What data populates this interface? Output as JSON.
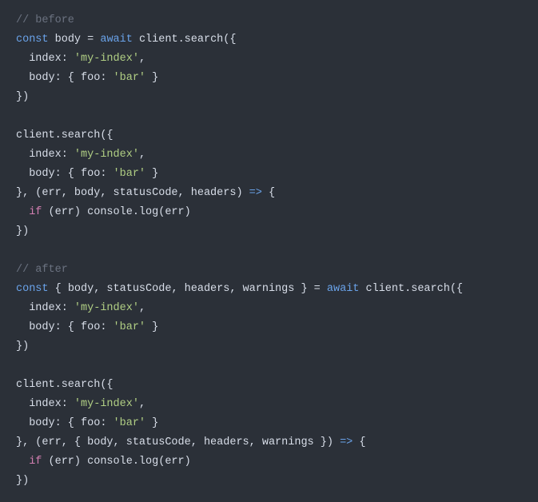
{
  "code": {
    "lines": [
      {
        "tokens": [
          {
            "t": "// before",
            "c": "cmt"
          }
        ]
      },
      {
        "tokens": [
          {
            "t": "const",
            "c": "kw"
          },
          {
            "t": " body ",
            "c": "ident"
          },
          {
            "t": "=",
            "c": "op"
          },
          {
            "t": " ",
            "c": "ident"
          },
          {
            "t": "await",
            "c": "kw"
          },
          {
            "t": " client.search({",
            "c": "ident"
          }
        ]
      },
      {
        "tokens": [
          {
            "t": "  index: ",
            "c": "ident"
          },
          {
            "t": "'my-index'",
            "c": "str"
          },
          {
            "t": ",",
            "c": "punct"
          }
        ]
      },
      {
        "tokens": [
          {
            "t": "  body: { foo: ",
            "c": "ident"
          },
          {
            "t": "'bar'",
            "c": "str"
          },
          {
            "t": " }",
            "c": "punct"
          }
        ]
      },
      {
        "tokens": [
          {
            "t": "})",
            "c": "punct"
          }
        ]
      },
      {
        "tokens": [
          {
            "t": "",
            "c": "ident"
          }
        ]
      },
      {
        "tokens": [
          {
            "t": "client.search({",
            "c": "ident"
          }
        ]
      },
      {
        "tokens": [
          {
            "t": "  index: ",
            "c": "ident"
          },
          {
            "t": "'my-index'",
            "c": "str"
          },
          {
            "t": ",",
            "c": "punct"
          }
        ]
      },
      {
        "tokens": [
          {
            "t": "  body: { foo: ",
            "c": "ident"
          },
          {
            "t": "'bar'",
            "c": "str"
          },
          {
            "t": " }",
            "c": "punct"
          }
        ]
      },
      {
        "tokens": [
          {
            "t": "}, (err, body, statusCode, headers) ",
            "c": "ident"
          },
          {
            "t": "=>",
            "c": "kw"
          },
          {
            "t": " {",
            "c": "punct"
          }
        ]
      },
      {
        "tokens": [
          {
            "t": "  ",
            "c": "ident"
          },
          {
            "t": "if",
            "c": "kw2"
          },
          {
            "t": " (err) console.log(err)",
            "c": "ident"
          }
        ]
      },
      {
        "tokens": [
          {
            "t": "})",
            "c": "punct"
          }
        ]
      },
      {
        "tokens": [
          {
            "t": "",
            "c": "ident"
          }
        ]
      },
      {
        "tokens": [
          {
            "t": "// after",
            "c": "cmt"
          }
        ]
      },
      {
        "tokens": [
          {
            "t": "const",
            "c": "kw"
          },
          {
            "t": " { body, statusCode, headers, warnings } ",
            "c": "ident"
          },
          {
            "t": "=",
            "c": "op"
          },
          {
            "t": " ",
            "c": "ident"
          },
          {
            "t": "await",
            "c": "kw"
          },
          {
            "t": " client.search({",
            "c": "ident"
          }
        ]
      },
      {
        "tokens": [
          {
            "t": "  index: ",
            "c": "ident"
          },
          {
            "t": "'my-index'",
            "c": "str"
          },
          {
            "t": ",",
            "c": "punct"
          }
        ]
      },
      {
        "tokens": [
          {
            "t": "  body: { foo: ",
            "c": "ident"
          },
          {
            "t": "'bar'",
            "c": "str"
          },
          {
            "t": " }",
            "c": "punct"
          }
        ]
      },
      {
        "tokens": [
          {
            "t": "})",
            "c": "punct"
          }
        ]
      },
      {
        "tokens": [
          {
            "t": "",
            "c": "ident"
          }
        ]
      },
      {
        "tokens": [
          {
            "t": "client.search({",
            "c": "ident"
          }
        ]
      },
      {
        "tokens": [
          {
            "t": "  index: ",
            "c": "ident"
          },
          {
            "t": "'my-index'",
            "c": "str"
          },
          {
            "t": ",",
            "c": "punct"
          }
        ]
      },
      {
        "tokens": [
          {
            "t": "  body: { foo: ",
            "c": "ident"
          },
          {
            "t": "'bar'",
            "c": "str"
          },
          {
            "t": " }",
            "c": "punct"
          }
        ]
      },
      {
        "tokens": [
          {
            "t": "}, (err, { body, statusCode, headers, warnings }) ",
            "c": "ident"
          },
          {
            "t": "=>",
            "c": "kw"
          },
          {
            "t": " {",
            "c": "punct"
          }
        ]
      },
      {
        "tokens": [
          {
            "t": "  ",
            "c": "ident"
          },
          {
            "t": "if",
            "c": "kw2"
          },
          {
            "t": " (err) console.log(err)",
            "c": "ident"
          }
        ]
      },
      {
        "tokens": [
          {
            "t": "})",
            "c": "punct"
          }
        ]
      }
    ]
  }
}
